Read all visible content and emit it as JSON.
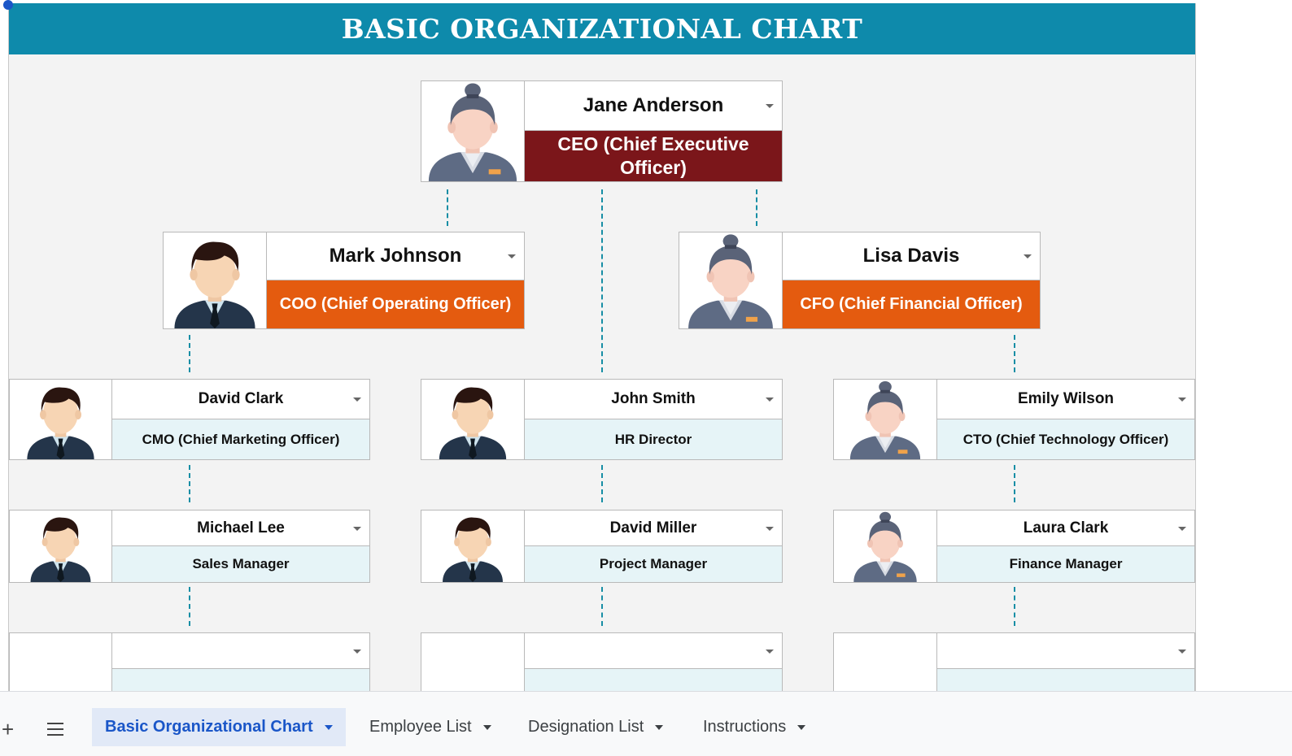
{
  "title": "BASIC ORGANIZATIONAL CHART",
  "org": {
    "ceo": {
      "name": "Jane Anderson",
      "role": "CEO (Chief Executive Officer)",
      "avatar": "female-avatar-icon"
    },
    "coo": {
      "name": "Mark Johnson",
      "role": "COO (Chief Operating Officer)",
      "avatar": "male-avatar-icon"
    },
    "cfo": {
      "name": "Lisa Davis",
      "role": "CFO (Chief Financial Officer)",
      "avatar": "female-avatar-icon"
    },
    "cmo": {
      "name": "David Clark",
      "role": "CMO (Chief Marketing Officer)",
      "avatar": "male-avatar-icon"
    },
    "hr": {
      "name": "John Smith",
      "role": "HR Director",
      "avatar": "male-avatar-icon"
    },
    "cto": {
      "name": "Emily Wilson",
      "role": "CTO (Chief Technology Officer)",
      "avatar": "female-avatar-icon"
    },
    "sales": {
      "name": "Michael Lee",
      "role": "Sales Manager",
      "avatar": "male-avatar-icon"
    },
    "pm": {
      "name": "David Miller",
      "role": "Project Manager",
      "avatar": "male-avatar-icon"
    },
    "finance": {
      "name": "Laura Clark",
      "role": "Finance Manager",
      "avatar": "female-avatar-icon"
    }
  },
  "colors": {
    "header": "#0e8aab",
    "ceo_role": "#7b161a",
    "exec_role": "#e45b0f",
    "staff_role": "#e6f4f7",
    "connector": "#178ea5"
  },
  "tabs": [
    {
      "label": "Basic Organizational Chart",
      "active": true
    },
    {
      "label": "Employee List"
    },
    {
      "label": "Designation List"
    },
    {
      "label": "Instructions"
    }
  ]
}
